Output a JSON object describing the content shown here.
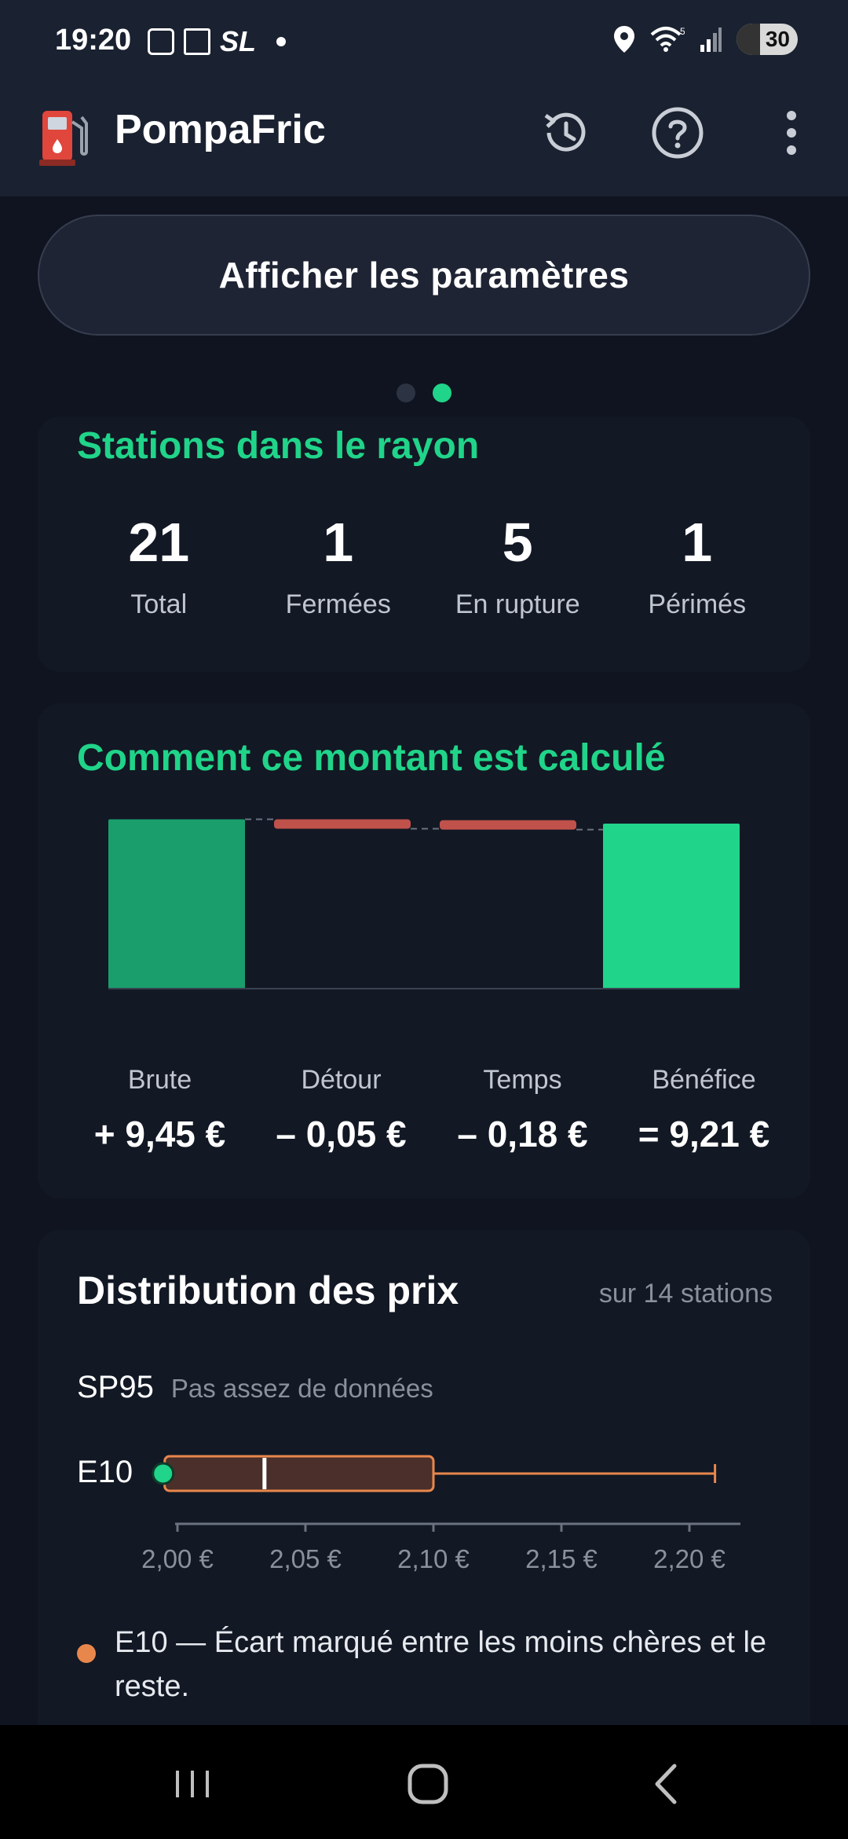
{
  "status_bar": {
    "time": "19:20",
    "carrier_label": "SL",
    "battery": "30",
    "icons": [
      "screenshot-icon",
      "folder-icon",
      "location-icon",
      "wifi-icon",
      "signal-icon",
      "battery-icon"
    ]
  },
  "app_bar": {
    "title": "PompaFric",
    "icons": [
      "fuel-pump-logo-icon",
      "history-icon",
      "help-icon",
      "more-vert-icon"
    ]
  },
  "params_button": {
    "label": "Afficher les paramètres"
  },
  "pager": {
    "pages": 2,
    "active_index": 1
  },
  "stations_card": {
    "title": "Stations dans le rayon",
    "stats": [
      {
        "value": "21",
        "label": "Total"
      },
      {
        "value": "1",
        "label": "Fermées"
      },
      {
        "value": "5",
        "label": "En rupture"
      },
      {
        "value": "1",
        "label": "Périmés"
      }
    ]
  },
  "calc_card": {
    "title": "Comment ce montant est calculé",
    "items": [
      {
        "name": "Brute",
        "value": "+ 9,45 €"
      },
      {
        "name": "Détour",
        "value": "– 0,05 €"
      },
      {
        "name": "Temps",
        "value": "– 0,18 €"
      },
      {
        "name": "Bénéfice",
        "value": "= 9,21 €"
      }
    ],
    "colors": {
      "gross": "#1a9e6c",
      "negative": "#c0524b",
      "net": "#20d489"
    }
  },
  "chart_data": {
    "type": "bar",
    "subtype": "waterfall",
    "categories": [
      "Brute",
      "Détour",
      "Temps",
      "Bénéfice"
    ],
    "values": [
      9.45,
      -0.05,
      -0.18,
      9.21
    ],
    "unit": "€"
  },
  "distribution_card": {
    "title": "Distribution des prix",
    "subtitle": "sur 14 stations",
    "sp95": {
      "fuel": "SP95",
      "status": "Pas assez de données"
    },
    "e10": {
      "fuel": "E10",
      "min": 1.995,
      "q1": 1.995,
      "median": 2.034,
      "q3": 2.1,
      "max": 2.21,
      "marker": 1.995
    },
    "axis_ticks": [
      "2,00 €",
      "2,05 €",
      "2,10 €",
      "2,15 €",
      "2,20 €"
    ],
    "axis_tick_values": [
      2.0,
      2.05,
      2.1,
      2.15,
      2.2
    ],
    "note": "E10 — Écart marqué entre les moins chères et le reste.",
    "colors": {
      "box_stroke": "#e8874c",
      "box_fill": "#4a2f2a",
      "marker": "#20d489"
    }
  },
  "nav_bar": {
    "buttons": [
      "recents",
      "home",
      "back"
    ]
  }
}
